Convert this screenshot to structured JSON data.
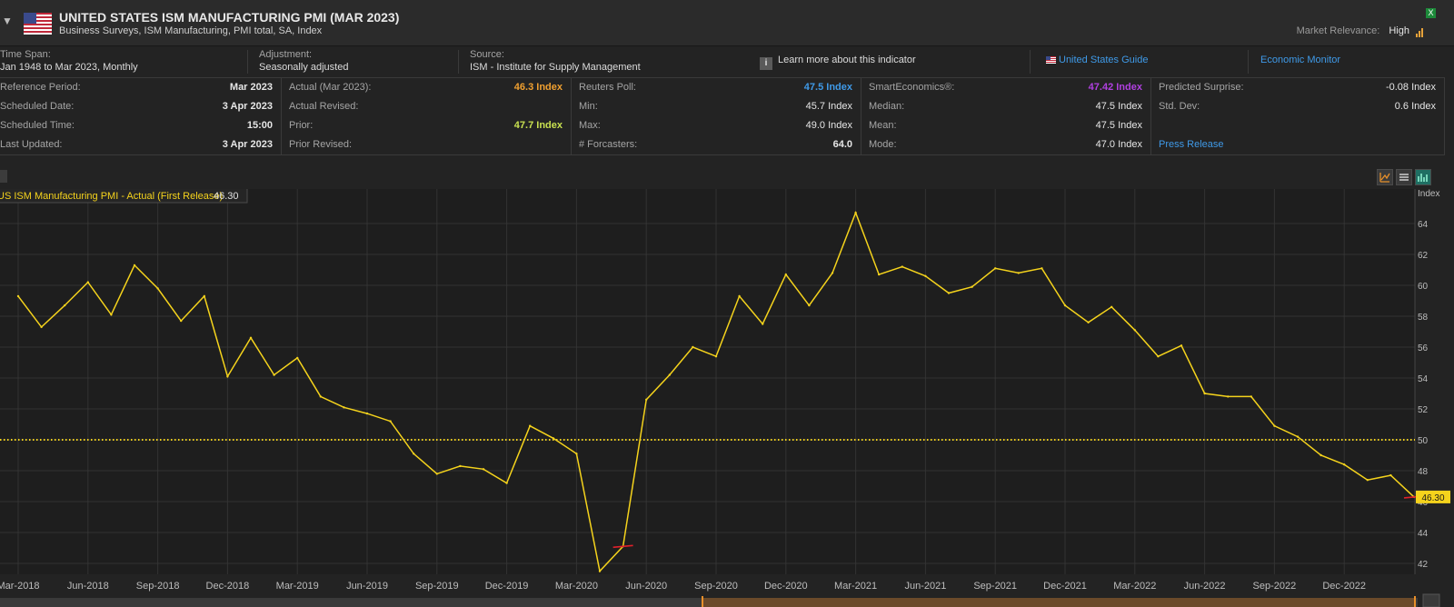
{
  "header": {
    "title": "UNITED STATES ISM MANUFACTURING PMI (MAR 2023)",
    "subtitle": "Business Surveys, ISM Manufacturing, PMI total, SA, Index",
    "market_relevance_label": "Market Relevance:",
    "market_relevance_value": "High",
    "excel_icon": "X"
  },
  "meta": {
    "time_span_label": "Time Span:",
    "time_span_value": "Jan 1948 to Mar 2023, Monthly",
    "adjustment_label": "Adjustment:",
    "adjustment_value": "Seasonally adjusted",
    "source_label": "Source:",
    "source_value": "ISM - Institute for Supply Management",
    "learn_more": "Learn more about this indicator",
    "country_guide": "United States Guide",
    "economic_monitor": "Economic Monitor"
  },
  "stats": {
    "col1": [
      {
        "k": "Reference Period:",
        "v": "Mar 2023"
      },
      {
        "k": "Scheduled Date:",
        "v": "3 Apr 2023"
      },
      {
        "k": "Scheduled Time:",
        "v": "15:00"
      },
      {
        "k": "Last Updated:",
        "v": "3 Apr 2023"
      }
    ],
    "col2": [
      {
        "k": "Actual (Mar 2023):",
        "v": "46.3 Index"
      },
      {
        "k": "Actual Revised:",
        "v": ""
      },
      {
        "k": "Prior:",
        "v": "47.7 Index"
      },
      {
        "k": "Prior Revised:",
        "v": ""
      }
    ],
    "col3": [
      {
        "k": "Reuters Poll:",
        "v": "47.5 Index"
      },
      {
        "k": "Min:",
        "v": "45.7 Index"
      },
      {
        "k": "Max:",
        "v": "49.0 Index"
      },
      {
        "k": "# Forcasters:",
        "v": "64.0"
      }
    ],
    "col4": [
      {
        "k": "SmartEconomics®:",
        "v": "47.42 Index"
      },
      {
        "k": "Median:",
        "v": "47.5 Index"
      },
      {
        "k": "Mean:",
        "v": "47.5 Index"
      },
      {
        "k": "Mode:",
        "v": "47.0 Index"
      }
    ],
    "col5": [
      {
        "k": "Predicted Surprise:",
        "v": "-0.08 Index"
      },
      {
        "k": "Std. Dev:",
        "v": "0.6 Index"
      },
      {
        "k": "",
        "v": ""
      },
      {
        "k": "Press Release",
        "v": ""
      }
    ]
  },
  "colors": {
    "actual": "#f0a030",
    "prior": "#c8e050",
    "reuters": "#3f9ae8",
    "smart": "#b040e0",
    "line": "#f5d31c",
    "link": "#3f9ae8"
  },
  "chart_data": {
    "type": "line",
    "legend": "US ISM Manufacturing PMI - Actual (First Release)",
    "legend_value": "46.30",
    "ylabel": "Index",
    "ylim": [
      41.5,
      66
    ],
    "yticks": [
      42,
      44,
      46,
      48,
      50,
      52,
      54,
      56,
      58,
      60,
      62,
      64
    ],
    "reference_line": 50,
    "last_value_label": "46.30",
    "x_tick_labels": [
      "Mar-2018",
      "Jun-2018",
      "Sep-2018",
      "Dec-2018",
      "Mar-2019",
      "Jun-2019",
      "Sep-2019",
      "Dec-2019",
      "Mar-2020",
      "Jun-2020",
      "Sep-2020",
      "Dec-2020",
      "Mar-2021",
      "Jun-2021",
      "Sep-2021",
      "Dec-2021",
      "Mar-2022",
      "Jun-2022",
      "Sep-2022",
      "Dec-2022"
    ],
    "x_start": "2018-03",
    "x_end": "2023-03",
    "series": [
      {
        "name": "US ISM Manufacturing PMI - Actual (First Release)",
        "values": [
          59.3,
          57.3,
          58.7,
          60.2,
          58.1,
          61.3,
          59.8,
          57.7,
          59.3,
          54.1,
          56.6,
          54.2,
          55.3,
          52.8,
          52.1,
          51.7,
          51.2,
          49.1,
          47.8,
          48.3,
          48.1,
          47.2,
          50.9,
          50.1,
          49.1,
          41.5,
          43.1,
          52.6,
          54.2,
          56.0,
          55.4,
          59.3,
          57.5,
          60.7,
          58.7,
          60.8,
          64.7,
          60.7,
          61.2,
          60.6,
          59.5,
          59.9,
          61.1,
          60.8,
          61.1,
          58.7,
          57.6,
          58.6,
          57.1,
          55.4,
          56.1,
          53.0,
          52.8,
          52.8,
          50.9,
          50.2,
          49.0,
          48.4,
          47.4,
          47.7,
          46.3
        ]
      }
    ],
    "surprise_markers": [
      {
        "x": "2020-05",
        "value": 43.1
      },
      {
        "x": "2023-03",
        "value": 46.3
      }
    ]
  }
}
